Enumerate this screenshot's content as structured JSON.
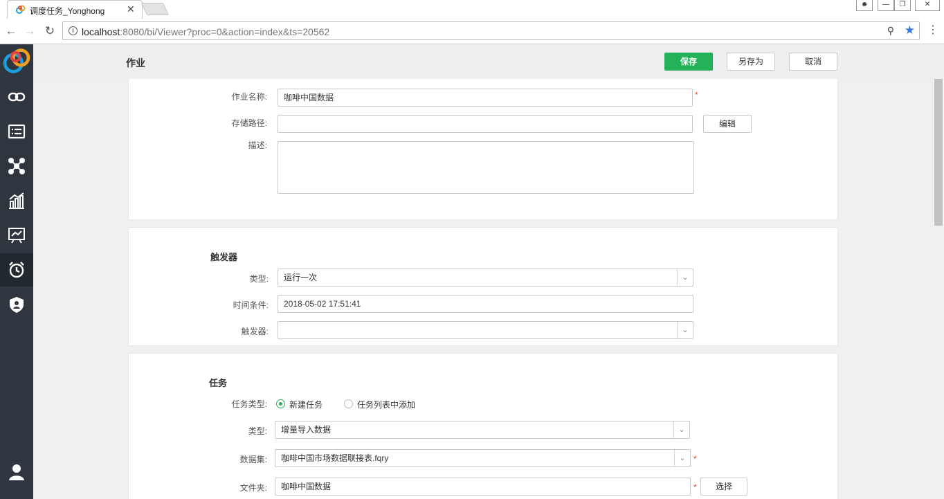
{
  "browser": {
    "tab_title": "调度任务_Yonghong",
    "tab_close": "✕",
    "url_host": "localhost",
    "url_rest": ":8080/bi/Viewer?proc=0&action=index&ts=20562"
  },
  "sidebar": {
    "items": [
      {
        "icon": "logo-icon"
      },
      {
        "icon": "link-icon"
      },
      {
        "icon": "list-icon"
      },
      {
        "icon": "network-icon"
      },
      {
        "icon": "chart-icon"
      },
      {
        "icon": "presentation-icon"
      },
      {
        "icon": "alarm-clock-icon",
        "active": true
      },
      {
        "icon": "shield-user-icon"
      },
      {
        "icon": "user-icon"
      }
    ]
  },
  "header": {
    "title": "作业",
    "save_label": "保存",
    "save_as_label": "另存为",
    "cancel_label": "取消"
  },
  "job": {
    "name_label": "作业名称:",
    "name_value": "咖啡中国数据",
    "path_label": "存储路径:",
    "path_value": "",
    "edit_label": "编辑",
    "desc_label": "描述:",
    "required_mark": "*"
  },
  "trigger": {
    "title": "触发器",
    "type_label": "类型:",
    "type_value": "运行一次",
    "time_label": "时间条件:",
    "time_value": "2018-05-02 17:51:41",
    "trigger_label": "触发器:",
    "trigger_value": ""
  },
  "task": {
    "title": "任务",
    "task_type_label": "任务类型:",
    "option_new": "新建任务",
    "option_from_list": "任务列表中添加",
    "type_label": "类型:",
    "type_value": "增量导入数据",
    "dataset_label": "数据集:",
    "dataset_value": "咖啡中国市场数据联接表.fqry",
    "folder_label": "文件夹:",
    "folder_value": "咖啡中国数据",
    "choose_label": "选择"
  },
  "colors": {
    "accent": "#25b15a",
    "sidebar_bg": "#2f3640",
    "required": "#e2403a"
  }
}
